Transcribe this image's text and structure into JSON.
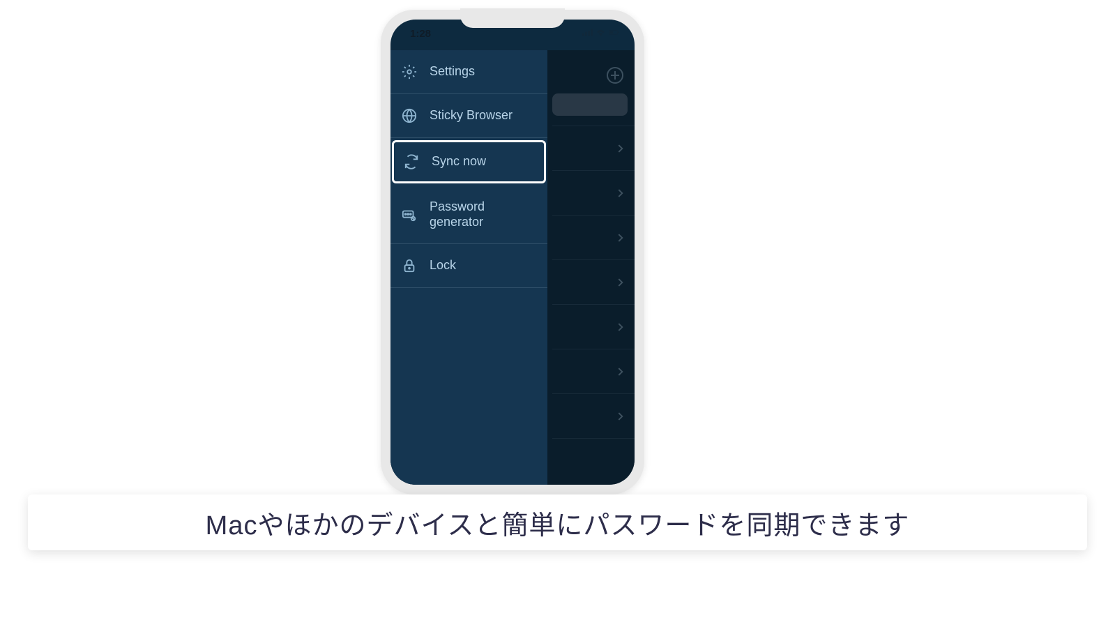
{
  "status": {
    "time": "1:28"
  },
  "sidebar": {
    "items": [
      {
        "label": "Settings",
        "icon": "gear-icon"
      },
      {
        "label": "Sticky Browser",
        "icon": "globe-icon"
      },
      {
        "label": "Sync now",
        "icon": "sync-icon",
        "highlighted": true
      },
      {
        "label": "Password generator",
        "icon": "password-icon"
      },
      {
        "label": "Lock",
        "icon": "lock-icon"
      }
    ]
  },
  "caption": "Macやほかのデバイスと簡単にパスワードを同期できます",
  "background_list_rows": 7
}
